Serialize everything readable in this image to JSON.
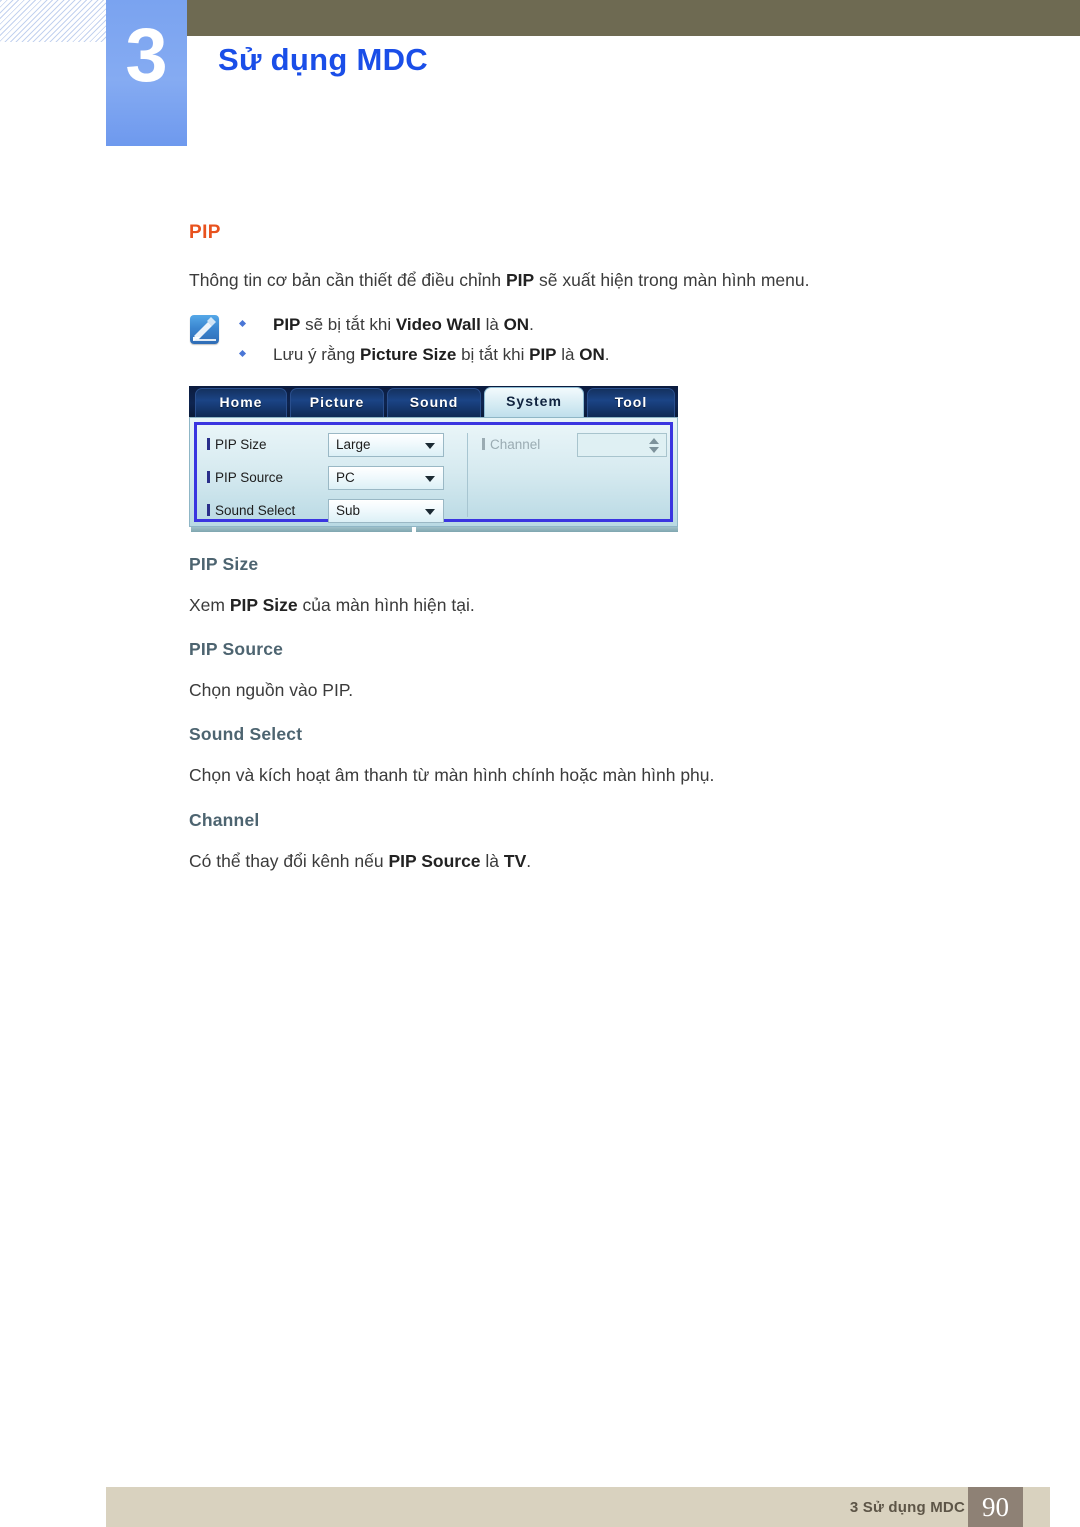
{
  "header": {
    "chapter_number": "3",
    "chapter_title": "Sử dụng MDC"
  },
  "section": {
    "title": "PIP",
    "intro_prefix": "Thông tin cơ bản cần thiết để điều chỉnh ",
    "intro_bold": "PIP",
    "intro_suffix": " sẽ xuất hiện trong màn hình menu."
  },
  "note": {
    "icon": "note-pen-icon",
    "bullets": [
      {
        "p1": "",
        "b1": "PIP",
        "p2": " sẽ bị tắt khi ",
        "b2": "Video Wall",
        "p3": " là ",
        "b3": "ON",
        "p4": "."
      },
      {
        "p1": "Lưu ý rằng ",
        "b1": "Picture Size",
        "p2": " bị tắt khi ",
        "b2": "PIP",
        "p3": " là ",
        "b3": "ON",
        "p4": "."
      }
    ]
  },
  "mdc": {
    "tabs": [
      {
        "label": "Home",
        "active": false
      },
      {
        "label": "Picture",
        "active": false
      },
      {
        "label": "Sound",
        "active": false
      },
      {
        "label": "System",
        "active": true
      },
      {
        "label": "Tool",
        "active": false
      }
    ],
    "fields": [
      {
        "label": "PIP Size",
        "value": "Large",
        "control": "dropdown",
        "disabled": false
      },
      {
        "label": "PIP Source",
        "value": "PC",
        "control": "dropdown",
        "disabled": false
      },
      {
        "label": "Sound Select",
        "value": "Sub",
        "control": "dropdown",
        "disabled": false
      },
      {
        "label": "Channel",
        "value": "",
        "control": "spinner",
        "disabled": true
      }
    ],
    "focus_border_color": "#3a35e0"
  },
  "subsections": [
    {
      "heading": "PIP Size",
      "p1": "Xem ",
      "b1": "PIP Size",
      "p2": " của màn hình hiện tại."
    },
    {
      "heading": "PIP Source",
      "p1": "Chọn nguồn vào PIP.",
      "b1": "",
      "p2": ""
    },
    {
      "heading": "Sound Select",
      "p1": "Chọn và kích hoạt âm thanh từ màn hình chính hoặc màn hình phụ.",
      "b1": "",
      "p2": ""
    },
    {
      "heading": "Channel",
      "p1": "Có thể thay đổi kênh nếu ",
      "b1": "PIP Source",
      "p2": " là ",
      "b2": "TV",
      "p3": "."
    }
  ],
  "footer": {
    "text": "3 Sử dụng MDC",
    "page_number": "90"
  },
  "colors": {
    "accent_orange": "#e8521e",
    "chapter_blue": "#1a4ee8",
    "heading_slate": "#4d6470",
    "olive": "#6e6a52",
    "footer_beige": "#d9d2bf",
    "footer_taupe": "#8e8175"
  }
}
